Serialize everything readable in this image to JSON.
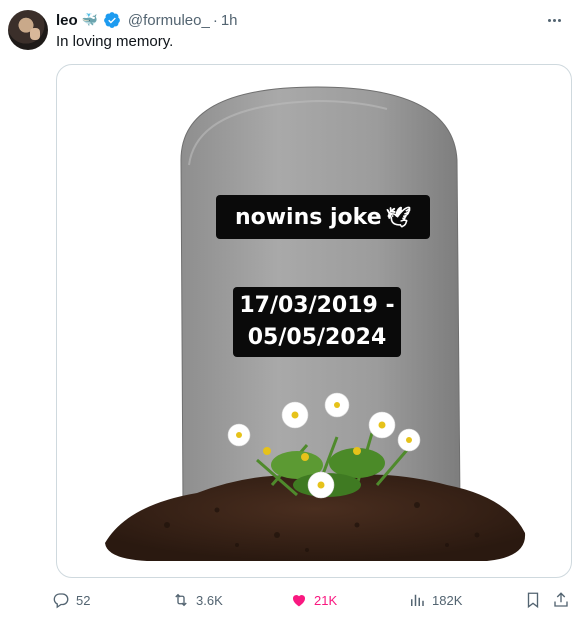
{
  "tweet": {
    "display_name": "leo",
    "handle": "@formuleo_",
    "separator": "·",
    "time": "1h",
    "text": "In loving memory.",
    "verified_color": "#1d9bf0",
    "more_icon": "more-horizontal-icon"
  },
  "media": {
    "plate_name": "nowins joke",
    "plate_dove": "🕊",
    "plate_dates_line1": "17/03/2019 -",
    "plate_dates_line2": "05/05/2024"
  },
  "actions": {
    "replies": "52",
    "reposts": "3.6K",
    "likes": "21K",
    "views": "182K",
    "like_color": "#f91880"
  }
}
